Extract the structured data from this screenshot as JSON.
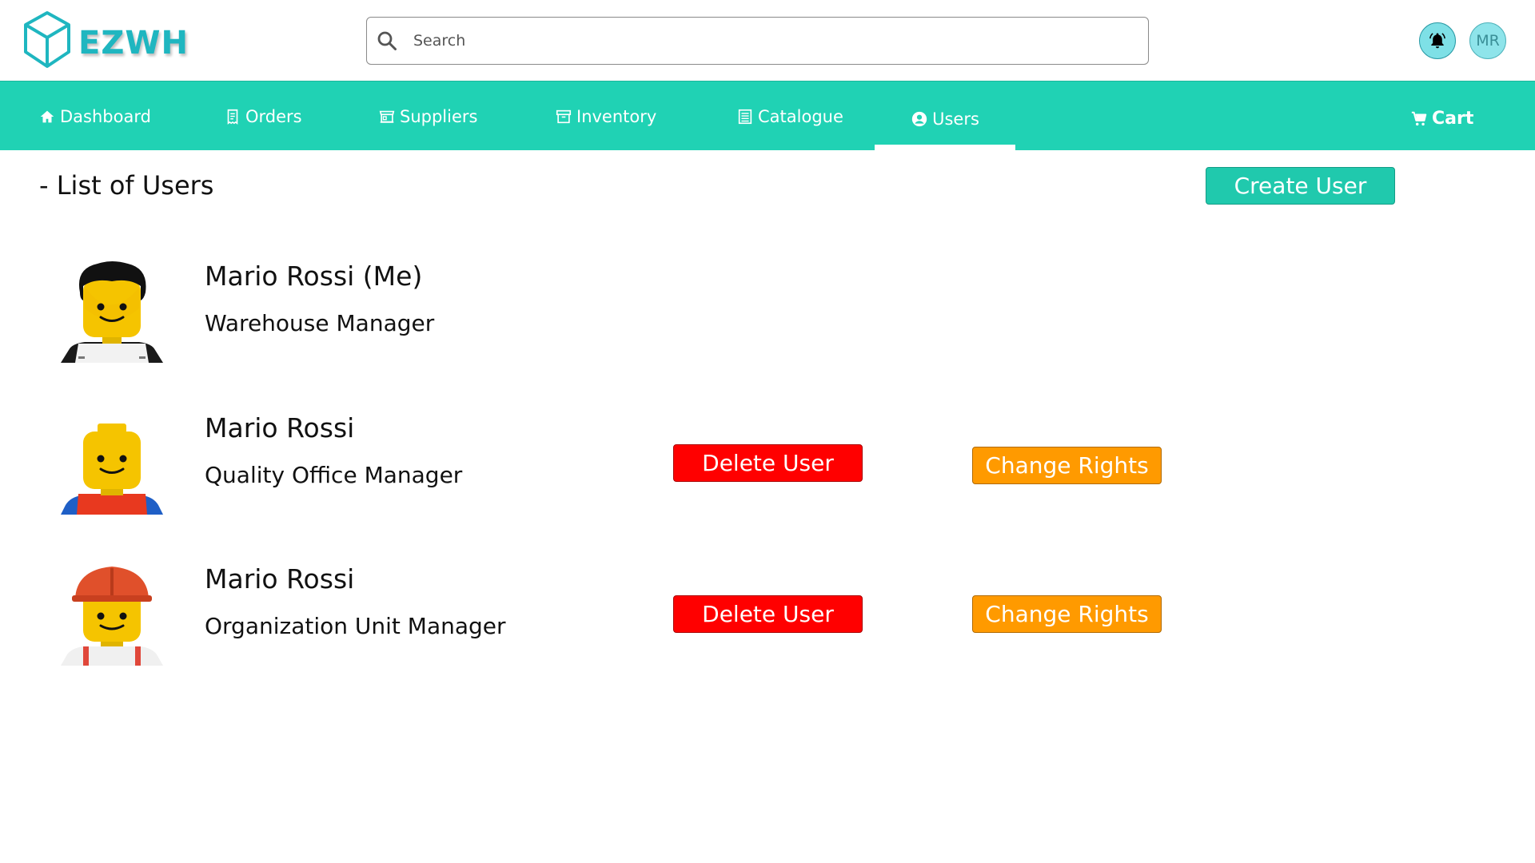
{
  "app": {
    "logo_text": "EZWH",
    "brand_color": "#1fb6c0",
    "accent": "#20d2b4"
  },
  "search": {
    "placeholder": "Search",
    "value": ""
  },
  "header": {
    "avatar_initials": "MR",
    "bell_icon": "bell-icon"
  },
  "nav": {
    "items": [
      {
        "label": "Dashboard",
        "icon": "home-icon"
      },
      {
        "label": "Orders",
        "icon": "receipt-icon"
      },
      {
        "label": "Suppliers",
        "icon": "store-icon"
      },
      {
        "label": "Inventory",
        "icon": "archive-icon"
      },
      {
        "label": "Catalogue",
        "icon": "list-icon"
      },
      {
        "label": "Users",
        "icon": "user-circle-icon",
        "active": true
      }
    ],
    "cart_label": "Cart"
  },
  "main": {
    "title": "- List of Users",
    "create_label": "Create User",
    "users": [
      {
        "name": "Mario Rossi (Me)",
        "role": "Warehouse Manager",
        "avatar": "lego-black-hair"
      },
      {
        "name": "Mario Rossi",
        "role": "Quality Office Manager",
        "avatar": "lego-bald",
        "delete_label": "Delete User",
        "rights_label": "Change Rights"
      },
      {
        "name": "Mario Rossi",
        "role": "Organization Unit Manager",
        "avatar": "lego-hardhat",
        "delete_label": "Delete User",
        "rights_label": "Change Rights"
      }
    ]
  },
  "colors": {
    "delete": "#ff0000",
    "change_rights": "#ff9a00",
    "create": "#20c9ad"
  }
}
